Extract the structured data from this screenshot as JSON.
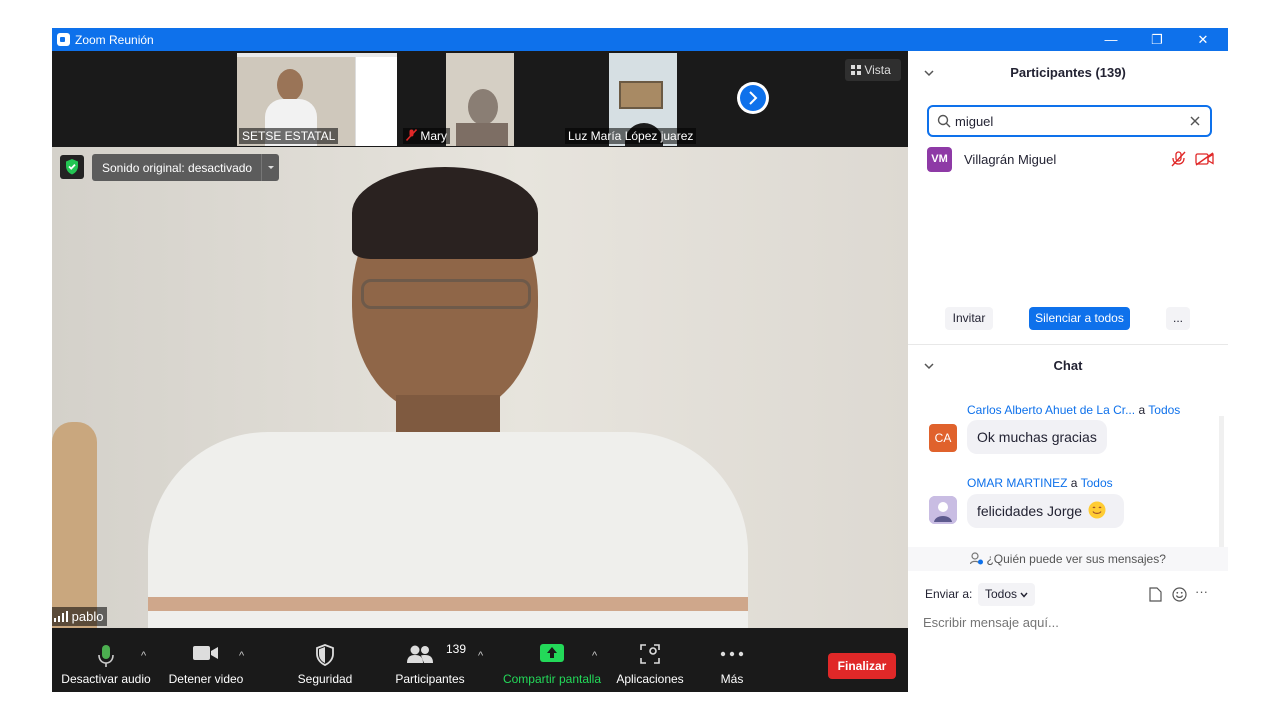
{
  "window": {
    "title": "Zoom Reunión",
    "minimize_glyph": "—",
    "restore_glyph": "❐",
    "close_glyph": "✕"
  },
  "thumbnails": [
    {
      "label": "SETSE ESTATAL",
      "muted": false
    },
    {
      "label": "Mary",
      "muted": true
    },
    {
      "label": "Luz María López juarez",
      "muted": false
    }
  ],
  "view_button": {
    "label": "Vista"
  },
  "main_video": {
    "sound_label": "Sonido original: desactivado",
    "speaker_name": "pablo"
  },
  "toolbar": {
    "audio": "Desactivar audio",
    "video": "Detener video",
    "security": "Seguridad",
    "participants": "Participantes",
    "participants_count": "139",
    "share": "Compartir pantalla",
    "apps": "Aplicaciones",
    "more": "Más",
    "end": "Finalizar"
  },
  "participants_panel": {
    "title": "Participantes (139)",
    "search_value": "miguel",
    "results": [
      {
        "initials": "VM",
        "name": "Villagrán Miguel",
        "avatar_color": "#8e3aa6",
        "audio_muted": true,
        "video_off": true
      }
    ],
    "invite": "Invitar",
    "mute_all": "Silenciar a todos",
    "more": "..."
  },
  "chat_panel": {
    "title": "Chat",
    "messages": [
      {
        "sender": "Carlos Alberto Ahuet de La Cr...",
        "to": "a Todos",
        "initials": "CA",
        "avatar_color": "#e0622c",
        "text": "Ok muchas gracias"
      },
      {
        "sender": "OMAR MARTINEZ",
        "to": "a Todos",
        "initials": "",
        "avatar_color": "#b6a6d6",
        "text": "felicidades Jorge"
      }
    ],
    "who_can_see": "¿Quién puede ver sus mensajes?",
    "send_to_label": "Enviar a:",
    "send_to_value": "Todos",
    "input_placeholder": "Escribir mensaje aquí...",
    "more": "···"
  },
  "colors": {
    "accent": "#0e71eb",
    "danger": "#e02828",
    "share_green": "#23d959"
  }
}
